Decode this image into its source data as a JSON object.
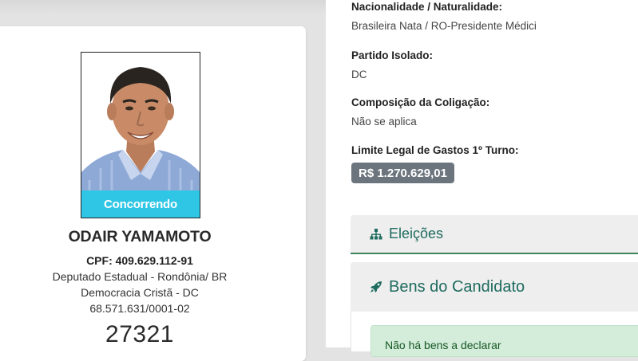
{
  "candidate": {
    "status": "Concorrendo",
    "name": "ODAIR YAMAMOTO",
    "cpf": "CPF: 409.629.112-91",
    "office": "Deputado Estadual - Rondônia/ BR",
    "party": "Democracia Cristã - DC",
    "cnpj": "68.571.631/0001-02",
    "number": "27321"
  },
  "details": {
    "nationality_label": "Nacionalidade / Naturalidade:",
    "nationality_value": "Brasileira Nata / RO-Presidente Médici",
    "party_label": "Partido Isolado:",
    "party_value": "DC",
    "coalition_label": "Composição da Coligação:",
    "coalition_value": "Não se aplica",
    "spending_label": "Limite Legal de Gastos 1º Turno:",
    "spending_value": "R$ 1.270.629,01"
  },
  "accordion": {
    "elections_label": "Eleições",
    "assets_label": "Bens do Candidato",
    "assets_message": "Não há bens a declarar"
  },
  "colors": {
    "status_banner": "#2fc6e6",
    "accent_green": "#1e6b5f",
    "badge_gray": "#6c757d",
    "alert_bg": "#d4edda"
  }
}
